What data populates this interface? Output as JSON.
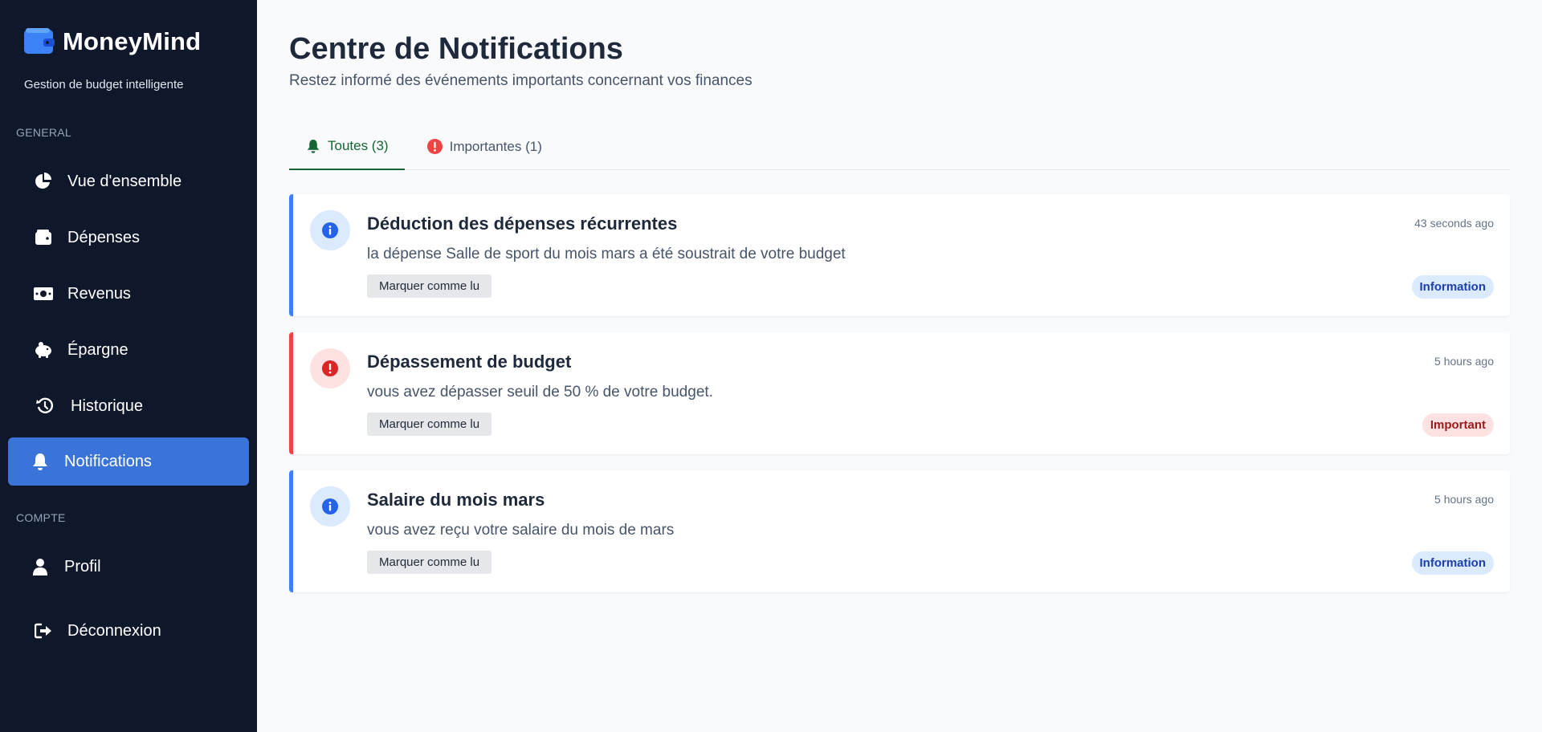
{
  "app": {
    "name": "MoneyMind",
    "tagline": "Gestion de budget intelligente"
  },
  "sidebar": {
    "sections": {
      "general": "GENERAL",
      "account": "COMPTE"
    },
    "items": [
      {
        "label": "Vue d'ensemble",
        "icon": "pie-chart-icon",
        "active": false
      },
      {
        "label": "Dépenses",
        "icon": "wallet-icon",
        "active": false
      },
      {
        "label": "Revenus",
        "icon": "money-bill-icon",
        "active": false
      },
      {
        "label": "Épargne",
        "icon": "piggy-bank-icon",
        "active": false
      },
      {
        "label": "Historique",
        "icon": "history-icon",
        "active": false
      },
      {
        "label": "Notifications",
        "icon": "bell-icon",
        "active": true
      },
      {
        "label": "Profil",
        "icon": "user-icon",
        "active": false
      },
      {
        "label": "Déconnexion",
        "icon": "logout-icon",
        "active": false
      }
    ]
  },
  "header": {
    "title": "Centre de Notifications",
    "subtitle": "Restez informé des événements importants concernant vos finances"
  },
  "tabs": [
    {
      "label": "Toutes (3)",
      "icon": "bell-icon",
      "active": true
    },
    {
      "label": "Importantes (1)",
      "icon": "exclamation-circle-icon",
      "active": false
    }
  ],
  "notifications": [
    {
      "title": "Déduction des dépenses récurrentes",
      "time": "43 seconds ago",
      "message": "la dépense Salle de sport du mois mars a été soustrait de votre budget",
      "action": "Marquer comme lu",
      "badge": "Information",
      "type": "info"
    },
    {
      "title": "Dépassement de budget",
      "time": "5 hours ago",
      "message": "vous avez dépasser seuil de 50 % de votre budget.",
      "action": "Marquer comme lu",
      "badge": "Important",
      "type": "important"
    },
    {
      "title": "Salaire du mois mars",
      "time": "5 hours ago",
      "message": "vous avez reçu votre salaire du mois de mars",
      "action": "Marquer comme lu",
      "badge": "Information",
      "type": "info"
    }
  ],
  "colors": {
    "sidebar_bg": "#0f172a",
    "active_nav": "#3b74d8",
    "info_accent": "#3b82f6",
    "important_accent": "#ef4444",
    "active_tab": "#166534"
  }
}
